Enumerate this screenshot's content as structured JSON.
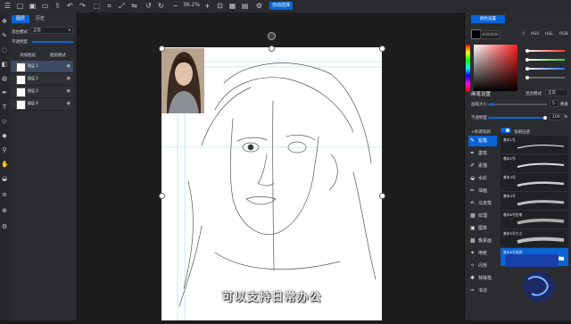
{
  "toolbar": {
    "zoom": "36.2%",
    "brush_badge": "自动选择",
    "icons": [
      "menu-icon",
      "new-icon",
      "save-icon",
      "folder-icon",
      "undo-icon",
      "redo-icon",
      "selection-icon",
      "crop-icon",
      "zoom-out-icon",
      "zoom-in-icon",
      "fit-icon",
      "rotate-icon",
      "flip-icon",
      "grid-icon",
      "ruler-icon"
    ]
  },
  "tools": [
    "move-tool-icon",
    "brush-tool-icon",
    "lasso-tool-icon",
    "eraser-tool-icon",
    "fill-tool-icon",
    "pen-tool-icon",
    "text-tool-icon",
    "shape-tool-icon",
    "smudge-tool-icon",
    "eyedropper-tool-icon",
    "hand-tool-icon",
    "layers-tool-icon",
    "settings-tool-icon"
  ],
  "layers_panel": {
    "tab_layer": "图层",
    "tab_history": "历史",
    "blend_label": "混合模式",
    "blend_value": "正常",
    "opacity_label": "不透明度",
    "action_new": "添加图层",
    "action_mode": "图层模式",
    "layers": [
      {
        "name": "图层 1",
        "selected": true
      },
      {
        "name": "图层 2",
        "selected": false
      },
      {
        "name": "图层 3",
        "selected": false
      },
      {
        "name": "图层 4",
        "selected": false
      }
    ]
  },
  "canvas": {
    "caption": "可以支持日常办公"
  },
  "right_panel": {
    "color_tab": "颜色设置",
    "hex_value": "#000000",
    "color_modes": [
      "HSV",
      "HSL",
      "RGB"
    ],
    "brush_settings_title": "画笔设置",
    "blend_label": "混合模式",
    "blend_value": "正常",
    "size_label": "画笔大小",
    "size_value": "5",
    "size_unit": "像素",
    "opacity_label": "不透明度",
    "opacity_value": "100",
    "opacity_unit": "%",
    "brush_set_label": "+新建笔刷",
    "toggle_label": "笔刷压感",
    "categories": [
      {
        "icon": "pencil-icon",
        "label": "铅笔",
        "selected": true
      },
      {
        "icon": "ink-icon",
        "label": "墨笔",
        "selected": false
      },
      {
        "icon": "dry-brush-icon",
        "label": "素描",
        "selected": false
      },
      {
        "icon": "watercolor-icon",
        "label": "水彩",
        "selected": false
      },
      {
        "icon": "oil-icon",
        "label": "油画",
        "selected": false
      },
      {
        "icon": "marker-icon",
        "label": "马克笔",
        "selected": false
      },
      {
        "icon": "texture-icon",
        "label": "纹理",
        "selected": false
      },
      {
        "icon": "pattern-icon",
        "label": "图章",
        "selected": false
      },
      {
        "icon": "pixel-icon",
        "label": "像素画",
        "selected": false
      },
      {
        "icon": "airbrush-icon",
        "label": "喷枪",
        "selected": false
      },
      {
        "icon": "smudge-icon",
        "label": "闪烁",
        "selected": false
      },
      {
        "icon": "special-icon",
        "label": "特殊笔",
        "selected": false
      },
      {
        "icon": "calligraphy-icon",
        "label": "书法",
        "selected": false
      }
    ],
    "brushes": [
      {
        "name": "基本1号",
        "selected": false
      },
      {
        "name": "基本2号",
        "selected": false
      },
      {
        "name": "基本3号",
        "selected": false
      },
      {
        "name": "基本4号",
        "selected": false
      },
      {
        "name": "基本6号铅笔",
        "selected": false
      },
      {
        "name": "基本5号大小",
        "selected": false
      },
      {
        "name": "基本6号笔刷",
        "selected": true
      }
    ]
  },
  "colors": {
    "accent": "#0a64d6",
    "panel": "#2b2c30",
    "canvas_bg": "#1d1d1f",
    "paper": "#ffffff"
  }
}
